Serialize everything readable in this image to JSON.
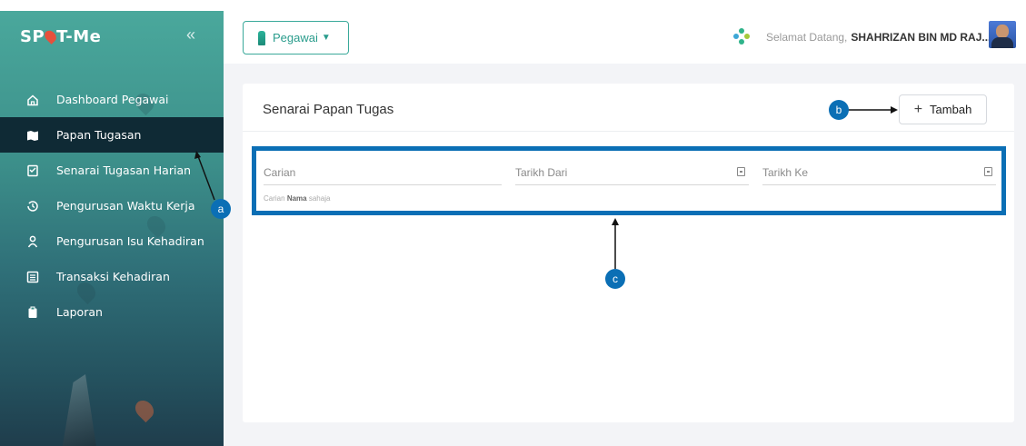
{
  "app": {
    "logo_prefix": "SP",
    "logo_suffix": "T-Me"
  },
  "sidebar": {
    "items": [
      {
        "label": "Dashboard Pegawai",
        "icon": "home-icon",
        "active": false
      },
      {
        "label": "Papan Tugasan",
        "icon": "task-board-icon",
        "active": true
      },
      {
        "label": "Senarai Tugasan Harian",
        "icon": "checklist-icon",
        "active": false
      },
      {
        "label": "Pengurusan Waktu Kerja",
        "icon": "clock-history-icon",
        "active": false
      },
      {
        "label": "Pengurusan Isu Kehadiran",
        "icon": "person-icon",
        "active": false
      },
      {
        "label": "Transaksi Kehadiran",
        "icon": "list-icon",
        "active": false
      },
      {
        "label": "Laporan",
        "icon": "clipboard-icon",
        "active": false
      }
    ]
  },
  "topbar": {
    "role": "Pegawai",
    "welcome_prefix": "Selamat Datang,",
    "user_name": "SHAHRIZAN BIN MD RAJ..."
  },
  "card": {
    "title": "Senarai Papan Tugas",
    "add_label": "Tambah"
  },
  "filters": {
    "search_placeholder": "Carian",
    "search_hint_prefix": "Carian",
    "search_hint_bold": "Nama",
    "search_hint_suffix": "sahaja",
    "date_from": "Tarikh Dari",
    "date_to": "Tarikh Ke"
  },
  "callouts": {
    "a": "a",
    "b": "b",
    "c": "c"
  },
  "colors": {
    "accent": "#3aa99a",
    "callout": "#0b6fb5",
    "active_nav": "#0f2a35"
  }
}
